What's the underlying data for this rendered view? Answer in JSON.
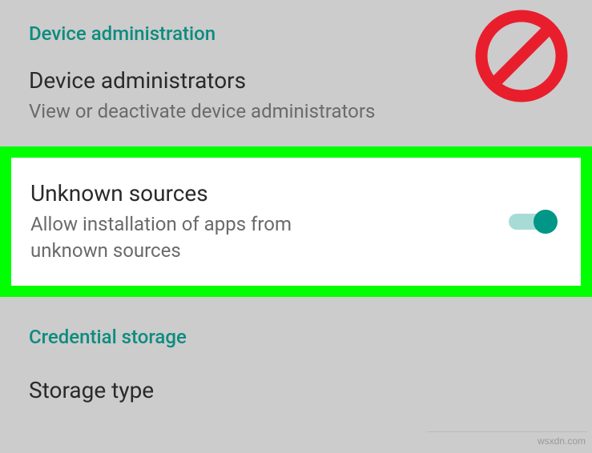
{
  "section1": {
    "header": "Device administration",
    "item1": {
      "title": "Device administrators",
      "subtitle": "View or deactivate device administrators"
    }
  },
  "highlighted": {
    "title": "Unknown sources",
    "subtitle": "Allow installation of apps from unknown sources",
    "toggle_on": true
  },
  "section2": {
    "header": "Credential storage",
    "item1": {
      "title": "Storage type"
    }
  },
  "watermark": "wsxdn.com",
  "colors": {
    "accent": "#009688",
    "highlight": "#00ff00",
    "prohibit": "#e91e2c"
  }
}
